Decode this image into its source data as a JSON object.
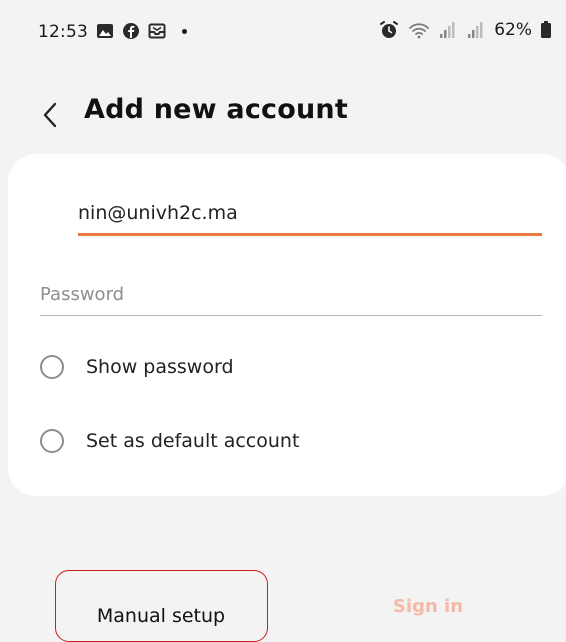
{
  "status_bar": {
    "time": "12:53",
    "battery": "62%",
    "left_icons": [
      "image-icon",
      "facebook-icon",
      "inbox-icon",
      "dot-icon"
    ],
    "right_icons": [
      "alarm-icon",
      "wifi-icon",
      "signal-icon",
      "signal-icon",
      "battery-icon"
    ]
  },
  "header": {
    "title": "Add new account",
    "back_icon": "chevron-left-icon"
  },
  "form": {
    "email_value": "nin@univh2c.ma",
    "password_placeholder": "Password",
    "show_password_label": "Show password",
    "default_account_label": "Set as default account"
  },
  "actions": {
    "manual_setup": "Manual setup",
    "sign_in": "Sign in"
  },
  "colors": {
    "accent": "#e87a3c",
    "sign_in_disabled": "#f5b9a6",
    "highlight_box": "#cc1b1b",
    "background": "#f3f3f3"
  }
}
